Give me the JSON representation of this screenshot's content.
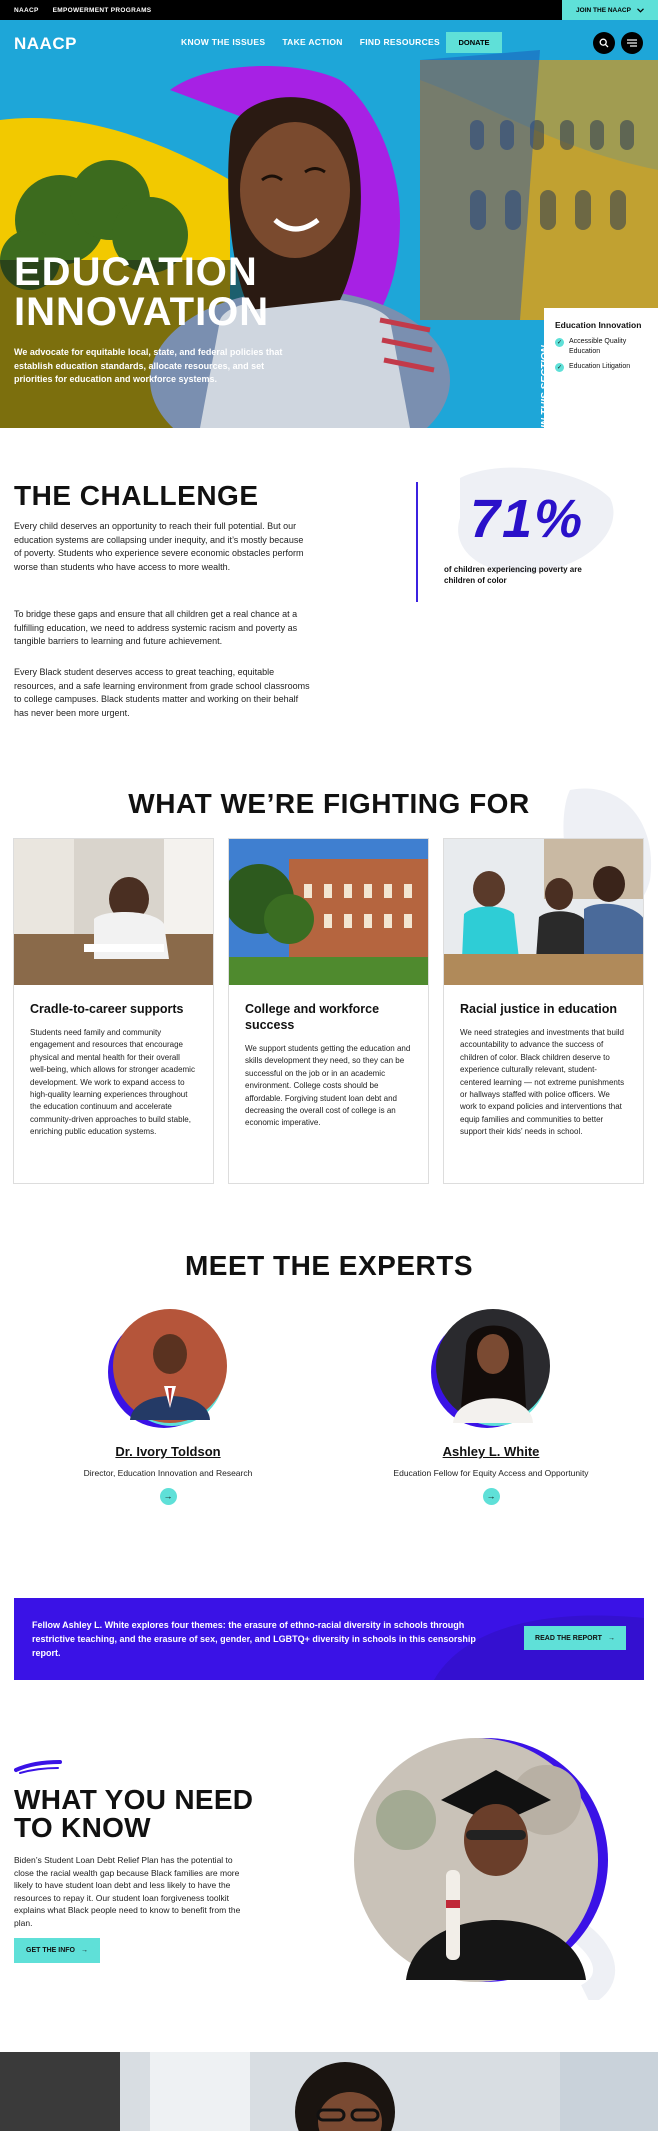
{
  "utility": {
    "links": [
      "NAACP",
      "EMPOWERMENT PROGRAMS"
    ],
    "join_label": "JOIN THE NAACP"
  },
  "nav": {
    "logo": "NAACP",
    "links": [
      "KNOW THE ISSUES",
      "TAKE ACTION",
      "FIND RESOURCES"
    ],
    "donate_label": "DONATE"
  },
  "hero": {
    "title_line1": "EDUCATION",
    "title_line2": "INNOVATION",
    "subtitle": "We advocate for equitable local, state, and federal policies that establish education standards, allocate resources, and set priorities for education and workforce systems.",
    "in_this_section_label": "IN THIS SECTION",
    "section_heading": "Education Innovation",
    "section_items": [
      "Accessible Quality Education",
      "Education Litigation"
    ]
  },
  "challenge": {
    "title": "THE CHALLENGE",
    "paragraphs": [
      "Every child deserves an opportunity to reach their full potential. But our education systems are collapsing under inequity, and it’s mostly because of poverty. Students who experience severe economic obstacles perform worse than students who have access to more wealth.",
      "To bridge these gaps and ensure that all children get a real chance at a fulfilling education, we need to address systemic racism and poverty as tangible barriers to learning and future achievement.",
      "Every Black student deserves access to great teaching, equitable resources, and a safe learning environment from grade school classrooms to college campuses. Black students matter and working on their behalf has never been more urgent."
    ],
    "stat_value": "71%",
    "stat_caption": "of children experiencing poverty are children of color"
  },
  "fighting": {
    "title": "WHAT WE’RE FIGHTING FOR",
    "cards": [
      {
        "title": "Cradle-to-career supports",
        "text": "Students need family and community engagement and resources that encourage physical and mental health for their overall well-being, which allows for stronger academic development. We work to expand access to high-quality learning experiences throughout the education continuum and accelerate community-driven approaches to build stable, enriching public education systems."
      },
      {
        "title": "College and workforce success",
        "text": "We support students getting the education and skills development they need, so they can be successful on the job or in an academic environment. College costs should be affordable. Forgiving student loan debt and decreasing the overall cost of college is an economic imperative."
      },
      {
        "title": "Racial justice in education",
        "text": "We need strategies and investments that build accountability to advance the success of children of color. Black children deserve to experience culturally relevant, student-centered learning — not extreme punishments or hallways staffed with police officers. We work to expand policies and interventions that equip families and communities to better support their kids’ needs in school."
      }
    ]
  },
  "experts": {
    "title": "MEET THE EXPERTS",
    "people": [
      {
        "name": "Dr. Ivory Toldson",
        "role": "Director, Education Innovation and Research"
      },
      {
        "name": "Ashley L. White",
        "role": "Education Fellow for Equity Access and Opportunity"
      }
    ]
  },
  "banner": {
    "text": "Fellow Ashley L. White explores four themes: the erasure of ethno-racial diversity in schools through restrictive teaching, and the erasure of sex, gender, and LGBTQ+ diversity in schools in this censorship report.",
    "button_label": "READ THE REPORT"
  },
  "know": {
    "title": "WHAT YOU NEED TO KNOW",
    "text": "Biden’s Student Loan Debt Relief Plan has the potential to close the racial wealth gap because Black families are more likely to have student loan debt and less likely to have the resources to repay it. Our student loan forgiveness toolkit explains what Black people need to know to benefit from the plan.",
    "button_label": "GET THE INFO"
  },
  "icons": {
    "chevron": "chevron-down-icon",
    "search": "search-icon",
    "menu": "menu-icon",
    "arrow": "arrow-right-icon",
    "check": "check-icon"
  },
  "colors": {
    "accent": "#5fe0d8",
    "brand_blue": "#3a12e6",
    "hero_yellow": "#f2c900",
    "hero_magenta": "#b613e6",
    "black": "#000000"
  }
}
